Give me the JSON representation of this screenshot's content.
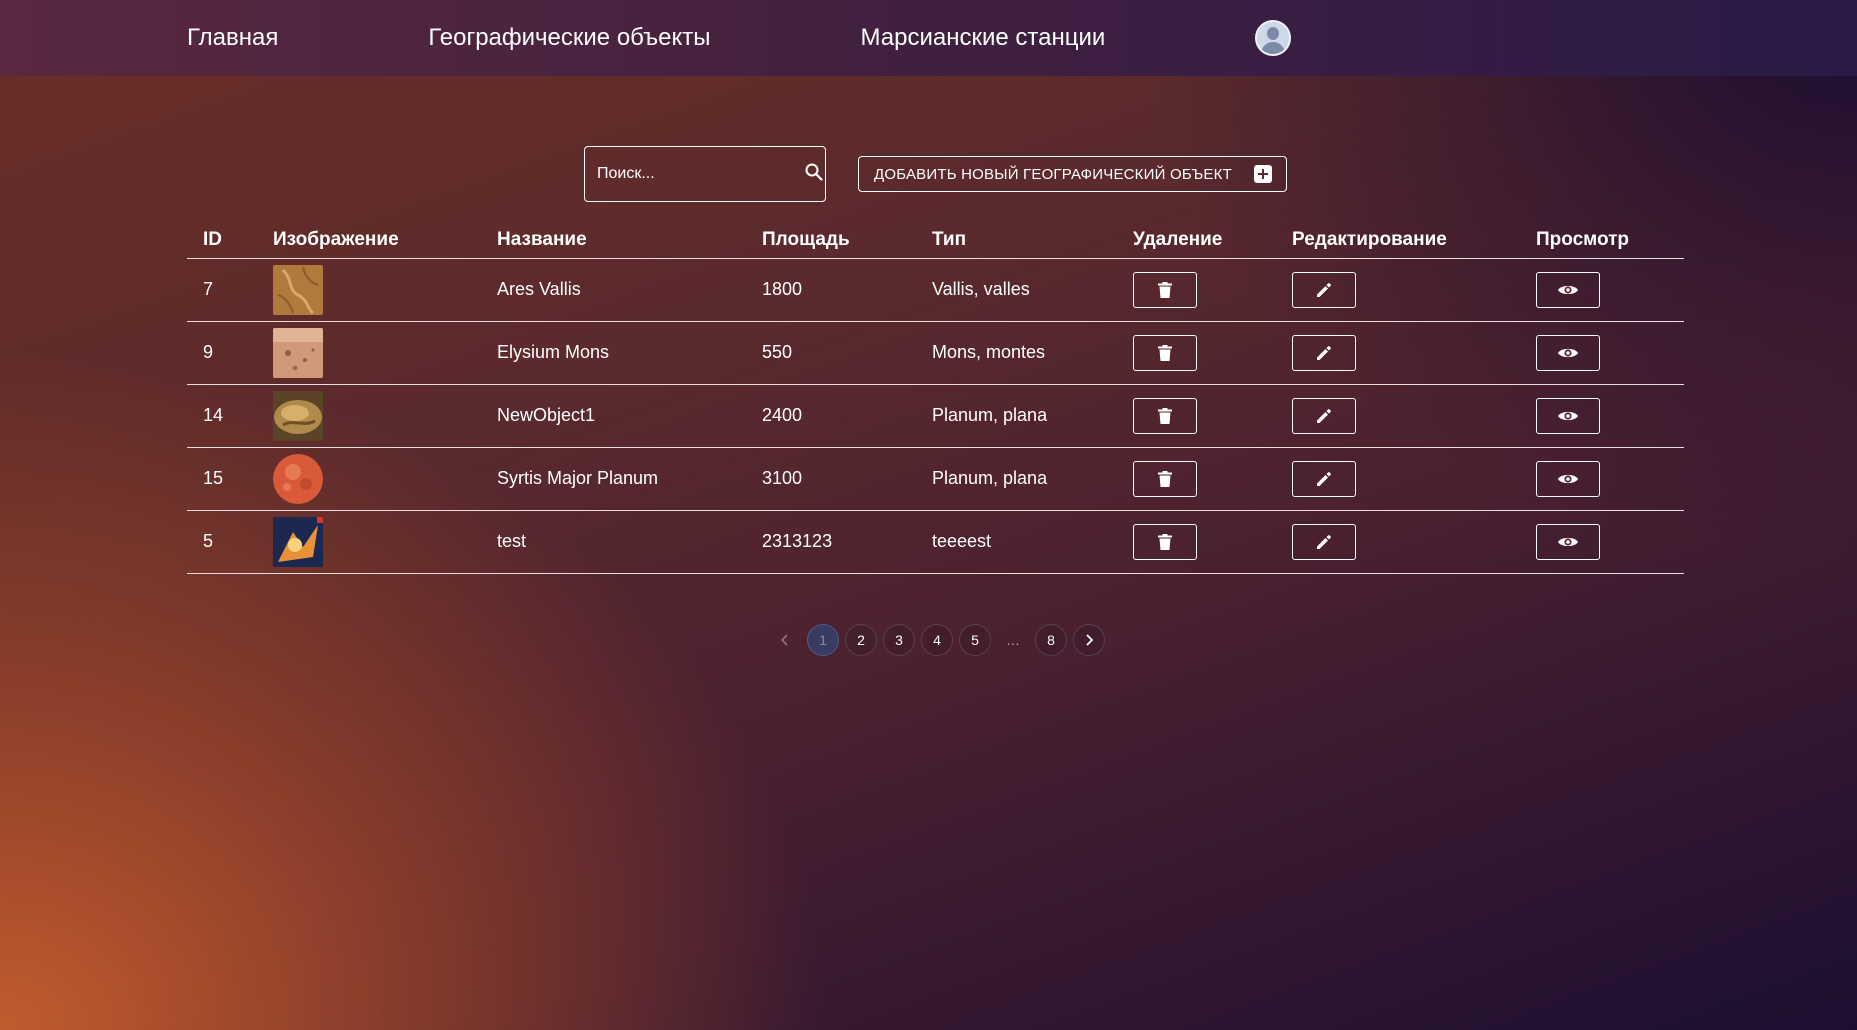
{
  "nav": {
    "home": "Главная",
    "geo_objects": "Географические объекты",
    "stations": "Марсианские станции",
    "avatar_icon": "user-avatar-icon"
  },
  "toolbar": {
    "search_placeholder": "Поиск...",
    "search_icon": "search-icon",
    "add_label": "ДОБАВИТЬ НОВЫЙ ГЕОГРАФИЧЕСКИЙ ОБЪЕКТ",
    "add_icon": "plus-square-icon"
  },
  "table": {
    "headers": [
      "ID",
      "Изображение",
      "Название",
      "Площадь",
      "Тип",
      "Удаление",
      "Редактирование",
      "Просмотр"
    ],
    "rows": [
      {
        "id": "7",
        "name": "Ares Vallis",
        "area": "1800",
        "type": "Vallis, valles"
      },
      {
        "id": "9",
        "name": "Elysium Mons",
        "area": "550",
        "type": "Mons, montes"
      },
      {
        "id": "14",
        "name": "NewObject1",
        "area": "2400",
        "type": "Planum, plana"
      },
      {
        "id": "15",
        "name": "Syrtis Major Planum",
        "area": "3100",
        "type": "Planum, plana"
      },
      {
        "id": "5",
        "name": "test",
        "area": "2313123",
        "type": "teeeest"
      }
    ]
  },
  "pagination": {
    "pages": [
      "1",
      "2",
      "3",
      "4",
      "5"
    ],
    "ellipsis": "…",
    "last": "8",
    "current": "1"
  },
  "colors": {
    "accent_active_page": "#7a86c8",
    "nav_bg": "#40203f"
  }
}
